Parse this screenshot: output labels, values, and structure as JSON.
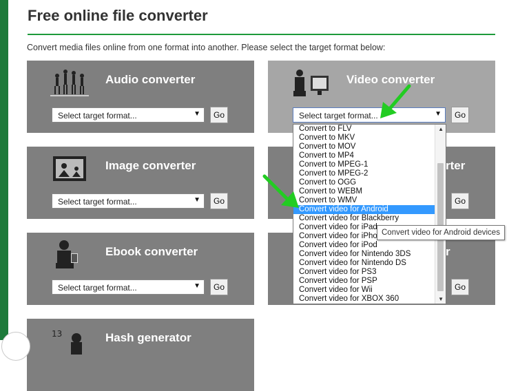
{
  "page": {
    "title": "Free online file converter",
    "subtitle": "Convert media files online from one format into another. Please select the target format below:"
  },
  "cards": {
    "audio": {
      "title": "Audio converter",
      "select_value": "Select target format...",
      "go_label": "Go"
    },
    "video": {
      "title": "Video converter",
      "select_value": "Select target format...",
      "go_label": "Go"
    },
    "image": {
      "title": "Image converter",
      "select_value": "Select target format...",
      "go_label": "Go"
    },
    "document": {
      "title_fragment": "rter",
      "go_label": "Go"
    },
    "ebook": {
      "title": "Ebook converter",
      "select_value": "Select target format...",
      "go_label": "Go"
    },
    "archive": {
      "title_fragment": "r",
      "go_label": "Go"
    },
    "hash": {
      "title": "Hash generator"
    }
  },
  "dropdown": {
    "items": [
      "Convert to FLV",
      "Convert to MKV",
      "Convert to MOV",
      "Convert to MP4",
      "Convert to MPEG-1",
      "Convert to MPEG-2",
      "Convert to OGG",
      "Convert to WEBM",
      "Convert to WMV",
      "Convert video for Android",
      "Convert video for Blackberry",
      "Convert video for iPad",
      "Convert video for iPhone",
      "Convert video for iPod",
      "Convert video for Nintendo 3DS",
      "Convert video for Nintendo DS",
      "Convert video for PS3",
      "Convert video for PSP",
      "Convert video for Wii",
      "Convert video for XBOX 360"
    ],
    "selected": "Convert video for Android"
  },
  "tooltip": {
    "text": "Convert video for Android devices"
  },
  "colors": {
    "accent": "#1d9a3a",
    "card": "#7f7f7f",
    "card_highlight": "#a6a6a6",
    "selection": "#3399ff",
    "arrow": "#22cc22"
  },
  "icons": [
    "dancers-icon",
    "tv-viewer-icon",
    "picture-frame-icon",
    "reader-icon",
    "hash-icon",
    "chevron-down-icon",
    "green-arrow-icon"
  ]
}
